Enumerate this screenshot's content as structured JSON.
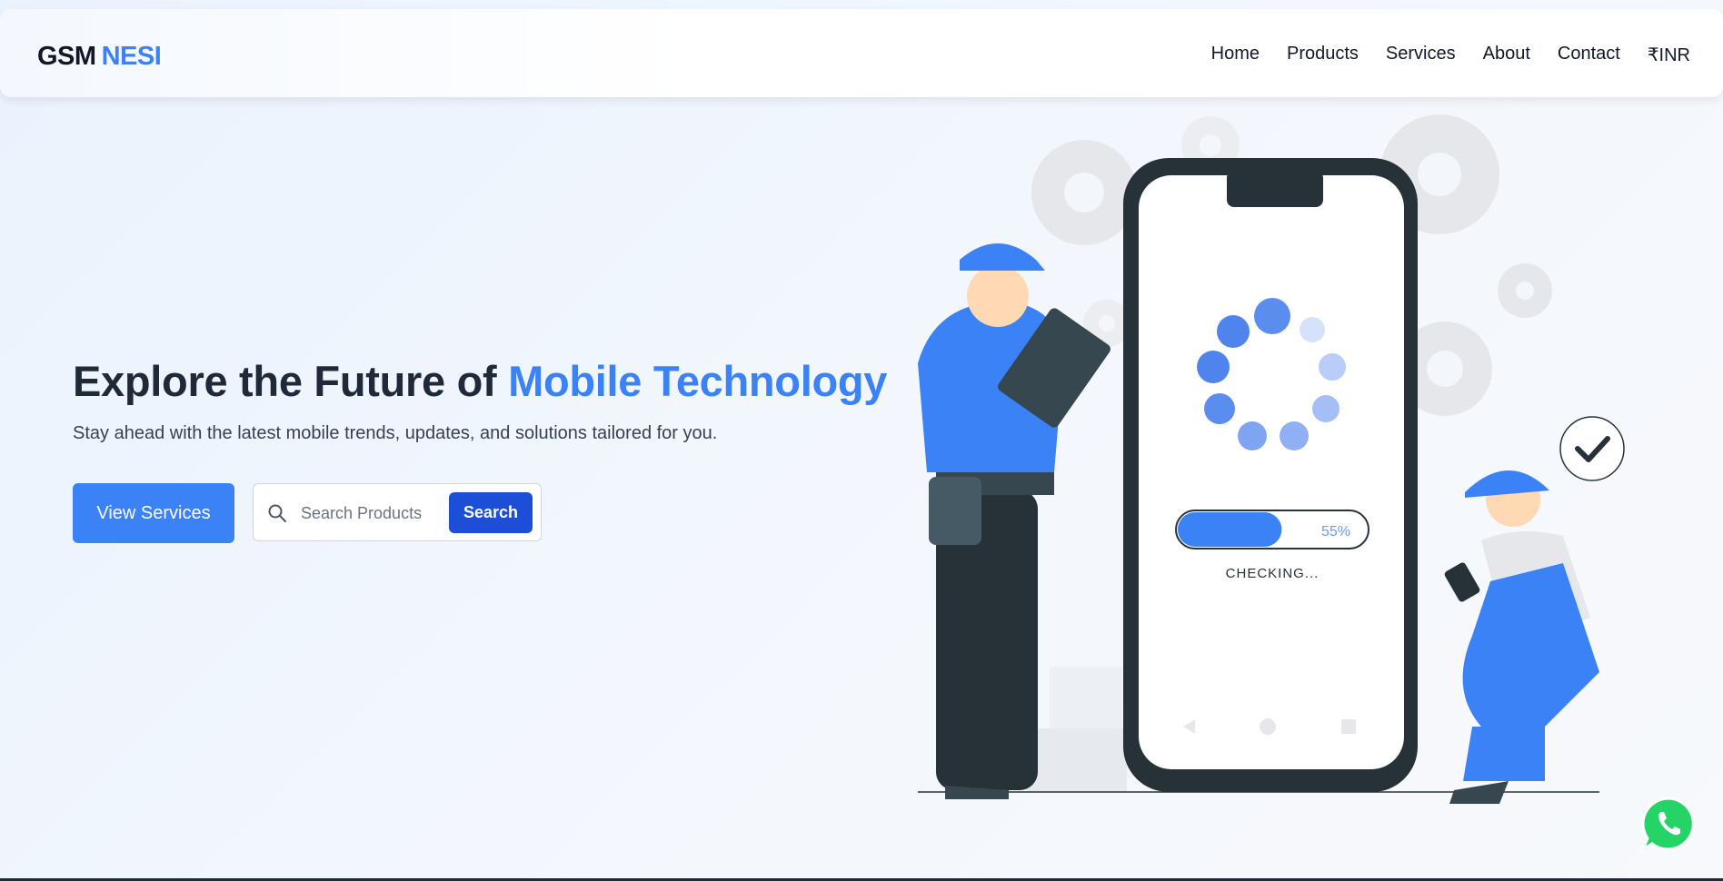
{
  "header": {
    "logo_part1": "GSM",
    "logo_part2": "NESI",
    "nav": [
      "Home",
      "Products",
      "Services",
      "About",
      "Contact",
      "₹INR"
    ]
  },
  "hero": {
    "title_part1": "Explore the Future of ",
    "title_part2": "Mobile Technology",
    "subtitle": "Stay ahead with the latest mobile trends, updates, and solutions tailored for you.",
    "cta_label": "View Services",
    "search_placeholder": "Search Products",
    "search_button": "Search"
  },
  "illustration": {
    "progress_percent": 55,
    "progress_label": "55%",
    "status_text": "CHECKING..."
  },
  "colors": {
    "accent": "#3b82f6",
    "accent_dark": "#1d4ed8",
    "text_dark": "#1f2937",
    "whatsapp": "#25d366"
  },
  "icons": [
    "search-icon",
    "whatsapp-icon",
    "checkmark-icon",
    "gear-icon"
  ]
}
